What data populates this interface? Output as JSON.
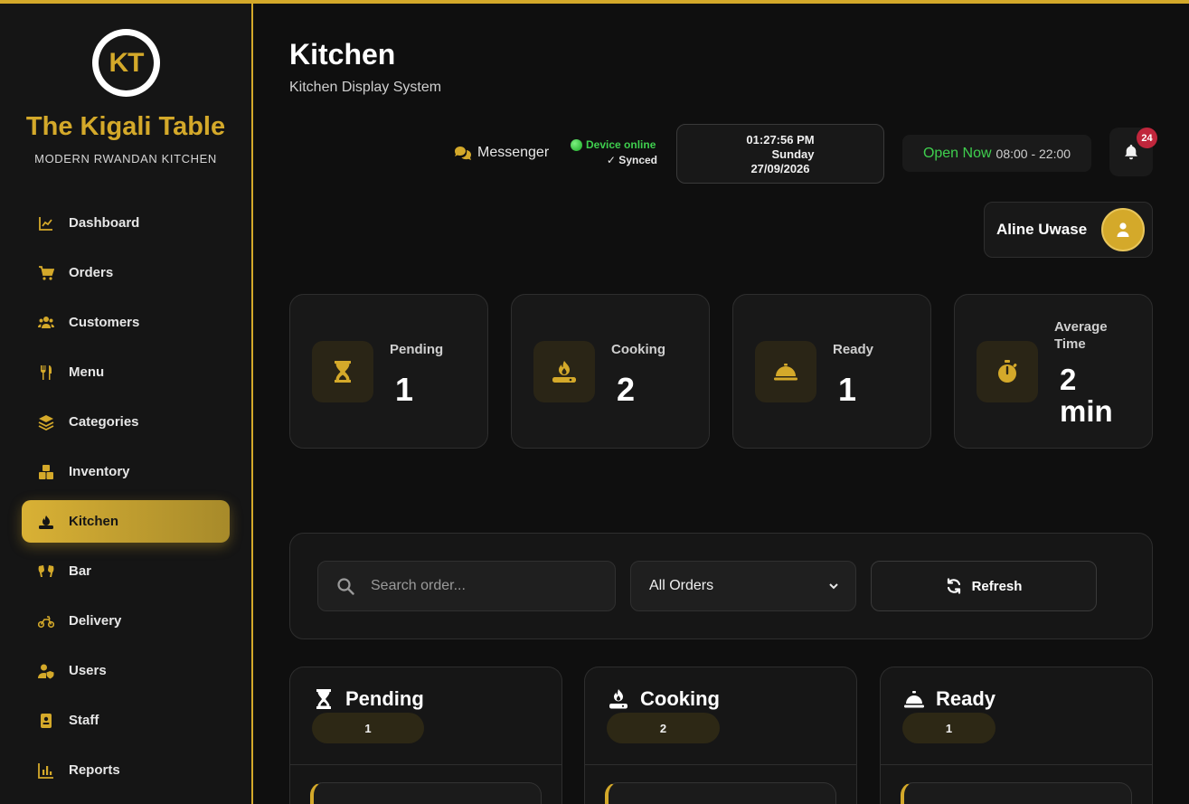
{
  "brand": {
    "logo_initials": "KT",
    "name": "The Kigali Table",
    "tagline": "MODERN RWANDAN KITCHEN",
    "accent_color": "#d4a92a"
  },
  "sidebar": {
    "items": [
      {
        "label": "Dashboard",
        "icon": "chart-line-icon",
        "active": false
      },
      {
        "label": "Orders",
        "icon": "cart-icon",
        "active": false
      },
      {
        "label": "Customers",
        "icon": "users-icon",
        "active": false
      },
      {
        "label": "Menu",
        "icon": "utensils-icon",
        "active": false
      },
      {
        "label": "Categories",
        "icon": "layers-icon",
        "active": false
      },
      {
        "label": "Inventory",
        "icon": "boxes-icon",
        "active": false
      },
      {
        "label": "Kitchen",
        "icon": "kitchen-burner-icon",
        "active": true
      },
      {
        "label": "Bar",
        "icon": "glasses-cheers-icon",
        "active": false
      },
      {
        "label": "Delivery",
        "icon": "motorcycle-icon",
        "active": false
      },
      {
        "label": "Users",
        "icon": "user-shield-icon",
        "active": false
      },
      {
        "label": "Staff",
        "icon": "id-badge-icon",
        "active": false
      },
      {
        "label": "Reports",
        "icon": "bar-chart-icon",
        "active": false
      }
    ]
  },
  "header": {
    "title": "Kitchen",
    "subtitle": "Kitchen Display System",
    "messenger_label": "Messenger",
    "device_status": "Device online",
    "sync_status": "✓ Synced",
    "clock": {
      "time": "01:27:56 PM",
      "day": "Sunday",
      "date": "27/09/2026"
    },
    "open_status": "Open Now",
    "open_hours": "08:00 - 22:00",
    "notification_count": "24",
    "user_name": "Aline Uwase"
  },
  "stats": [
    {
      "label": "Pending",
      "value": "1",
      "icon": "hourglass-icon"
    },
    {
      "label": "Cooking",
      "value": "2",
      "icon": "burner-icon"
    },
    {
      "label": "Ready",
      "value": "1",
      "icon": "concierge-bell-icon"
    },
    {
      "label": "Average Time",
      "value": "2 min",
      "icon": "stopwatch-icon"
    }
  ],
  "filters": {
    "search_placeholder": "Search order...",
    "select_value": "All Orders",
    "refresh_label": "Refresh"
  },
  "columns": [
    {
      "title": "Pending",
      "count": "1",
      "icon": "hourglass-icon"
    },
    {
      "title": "Cooking",
      "count": "2",
      "icon": "burner-icon"
    },
    {
      "title": "Ready",
      "count": "1",
      "icon": "concierge-bell-icon"
    }
  ]
}
